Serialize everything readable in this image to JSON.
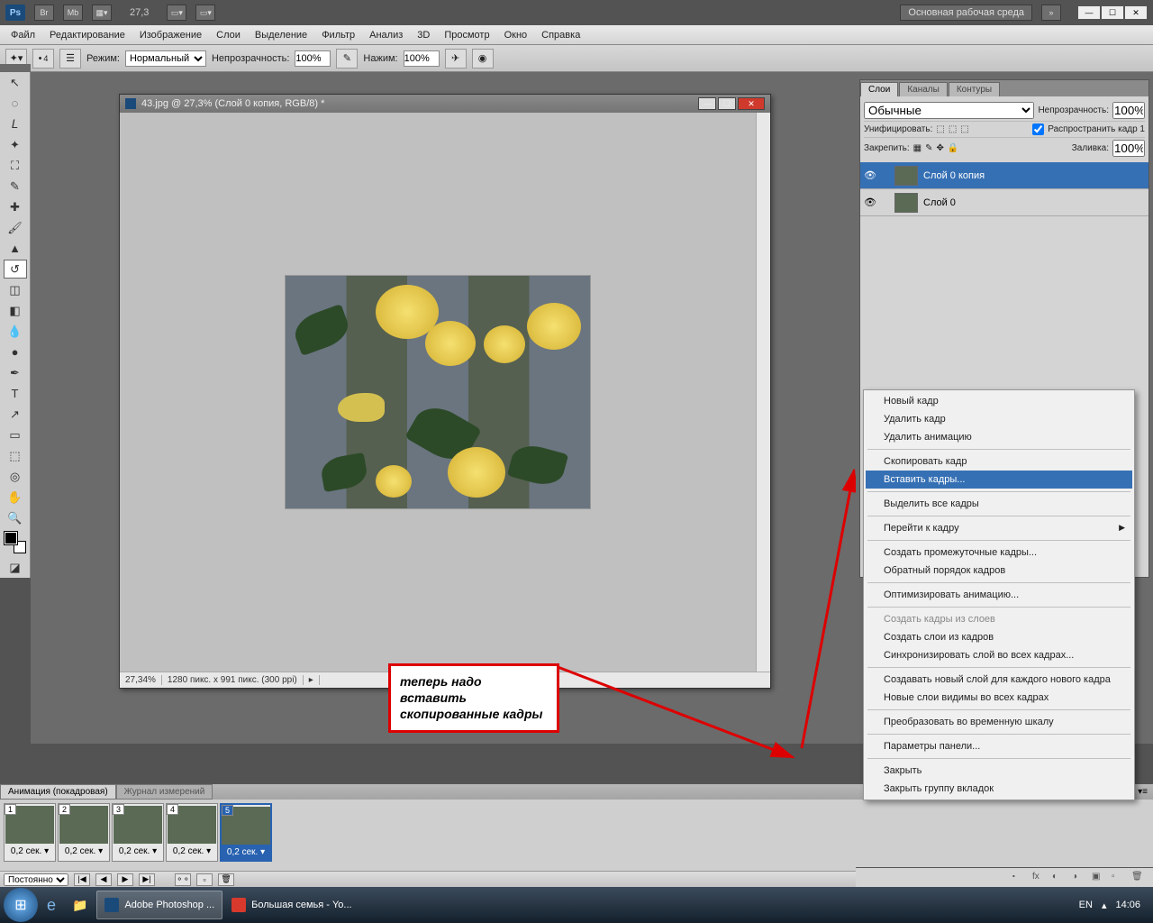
{
  "appbar": {
    "zoom": "27,3",
    "workspace_label": "Основная рабочая среда"
  },
  "menu": [
    "Файл",
    "Редактирование",
    "Изображение",
    "Слои",
    "Выделение",
    "Фильтр",
    "Анализ",
    "3D",
    "Просмотр",
    "Окно",
    "Справка"
  ],
  "options": {
    "brush_size": "4",
    "mode_label": "Режим:",
    "mode_value": "Нормальный",
    "opacity_label": "Непрозрачность:",
    "opacity_value": "100%",
    "flow_label": "Нажим:",
    "flow_value": "100%"
  },
  "document": {
    "title": "43.jpg @ 27,3% (Слой 0 копия, RGB/8) *",
    "status_zoom": "27,34%",
    "status_dims": "1280 пикс. x 991 пикс. (300 ppi)"
  },
  "layers_panel": {
    "tabs": [
      "Слои",
      "Каналы",
      "Контуры"
    ],
    "blend_value": "Обычные",
    "opacity_label": "Непрозрачность:",
    "opacity_value": "100%",
    "unify_label": "Унифицировать:",
    "propagate_label": "Распространить кадр 1",
    "lock_label": "Закрепить:",
    "fill_label": "Заливка:",
    "fill_value": "100%",
    "layers": [
      {
        "name": "Слой 0 копия",
        "selected": true
      },
      {
        "name": "Слой 0",
        "selected": false
      }
    ]
  },
  "animation_panel": {
    "tab1": "Анимация (покадровая)",
    "tab2": "Журнал измерений",
    "loop": "Постоянно",
    "frames": [
      {
        "n": "1",
        "time": "0,2 сек."
      },
      {
        "n": "2",
        "time": "0,2 сек."
      },
      {
        "n": "3",
        "time": "0,2 сек."
      },
      {
        "n": "4",
        "time": "0,2 сек."
      },
      {
        "n": "5",
        "time": "0,2 сек."
      }
    ]
  },
  "context_menu": [
    {
      "label": "Новый кадр",
      "type": "item"
    },
    {
      "label": "Удалить кадр",
      "type": "item"
    },
    {
      "label": "Удалить анимацию",
      "type": "item"
    },
    {
      "type": "sep"
    },
    {
      "label": "Скопировать кадр",
      "type": "item"
    },
    {
      "label": "Вставить кадры...",
      "type": "item",
      "highlighted": true
    },
    {
      "type": "sep"
    },
    {
      "label": "Выделить все кадры",
      "type": "item"
    },
    {
      "type": "sep"
    },
    {
      "label": "Перейти к кадру",
      "type": "item",
      "submenu": true
    },
    {
      "type": "sep"
    },
    {
      "label": "Создать промежуточные кадры...",
      "type": "item"
    },
    {
      "label": "Обратный порядок кадров",
      "type": "item"
    },
    {
      "type": "sep"
    },
    {
      "label": "Оптимизировать анимацию...",
      "type": "item"
    },
    {
      "type": "sep"
    },
    {
      "label": "Создать кадры из слоев",
      "type": "item",
      "disabled": true
    },
    {
      "label": "Создать слои из кадров",
      "type": "item"
    },
    {
      "label": "Синхронизировать слой во всех кадрах...",
      "type": "item"
    },
    {
      "type": "sep"
    },
    {
      "label": "Создавать новый слой для каждого нового кадра",
      "type": "item"
    },
    {
      "label": "Новые слои видимы во всех кадрах",
      "type": "item"
    },
    {
      "type": "sep"
    },
    {
      "label": "Преобразовать во временную шкалу",
      "type": "item"
    },
    {
      "type": "sep"
    },
    {
      "label": "Параметры панели...",
      "type": "item"
    },
    {
      "type": "sep"
    },
    {
      "label": "Закрыть",
      "type": "item"
    },
    {
      "label": "Закрыть группу вкладок",
      "type": "item"
    }
  ],
  "annotation": "теперь надо вставить скопированные кадры",
  "taskbar": {
    "apps": [
      {
        "label": "Adobe Photoshop ...",
        "active": true,
        "icon_color": "#1a4a7a"
      },
      {
        "label": "Большая семья - Yo...",
        "active": false,
        "icon_color": "#d73a2d"
      }
    ],
    "lang": "EN",
    "time": "14:06"
  }
}
